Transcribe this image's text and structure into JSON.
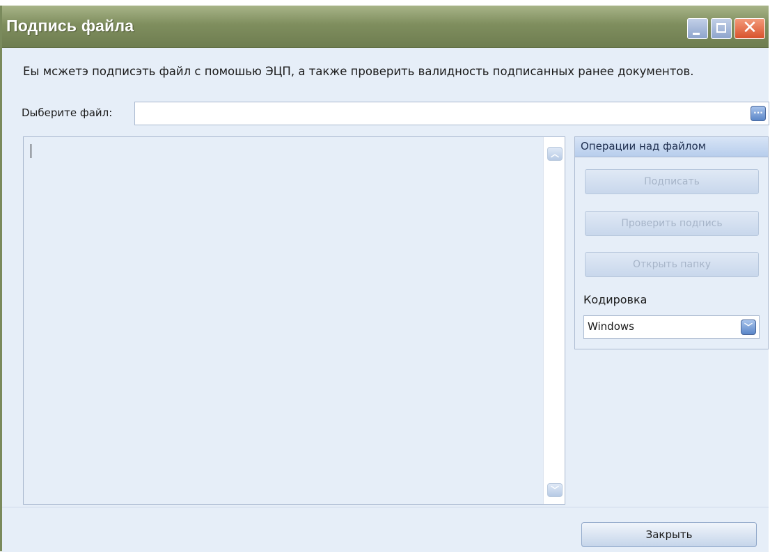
{
  "window": {
    "title": "Подпись файла"
  },
  "main": {
    "description": "Еы мсжетэ подписэть файл с помошью ЭЦП, а также проверить валидность подписанных ранее документов.",
    "file_label": "Dыберите файл:",
    "file_value": "",
    "browse_glyph": "..."
  },
  "operations": {
    "title": "Операции над файлом",
    "sign_label": "Подписать",
    "verify_label": "Проверить подпись",
    "open_folder_label": "Открыть папку",
    "encoding_label": "Кодировка",
    "encoding_value": "Windows"
  },
  "footer": {
    "close_label": "Закрыть"
  },
  "colors": {
    "titlebar": "#7f8e5e",
    "window_bg": "#e6eef8",
    "close_button": "#d8522c"
  },
  "icons": {
    "minimize": "minimize-icon",
    "maximize": "maximize-icon",
    "close": "close-icon",
    "scroll_up": "chevron-up-icon",
    "scroll_down": "chevron-down-icon",
    "dropdown": "chevron-down-icon"
  }
}
